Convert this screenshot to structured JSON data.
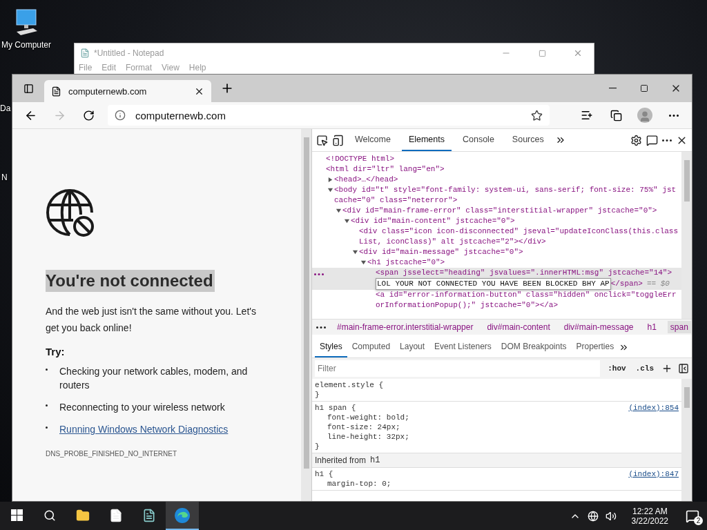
{
  "desktop_icons": [
    {
      "label": "My Computer"
    },
    {
      "label": "Da"
    },
    {
      "label": "N"
    }
  ],
  "notepad": {
    "title": "*Untitled - Notepad",
    "menu": [
      "File",
      "Edit",
      "Format",
      "View",
      "Help"
    ]
  },
  "browser": {
    "tabs": [
      {
        "title": "computernewb.com",
        "selected": true
      }
    ],
    "address": "computernewb.com"
  },
  "page": {
    "heading": "You're not connected",
    "heading_highlighted": true,
    "body": "And the web just isn't the same without you. Let's get you back online!",
    "try_label": "Try:",
    "suggestions": [
      {
        "kind": "text",
        "text": "Checking your network cables, modem, and routers"
      },
      {
        "kind": "text",
        "text": "Reconnecting to your wireless network"
      },
      {
        "kind": "link",
        "text": "Running Windows Network Diagnostics"
      }
    ],
    "error_code": "DNS_PROBE_FINISHED_NO_INTERNET"
  },
  "devtools": {
    "tabs": [
      {
        "label": "Welcome",
        "selected": false
      },
      {
        "label": "Elements",
        "selected": true
      },
      {
        "label": "Console",
        "selected": false
      },
      {
        "label": "Sources",
        "selected": false
      }
    ],
    "dom": [
      {
        "text": "<!DOCTYPE html>",
        "selected": false
      },
      {
        "text": "<html dir=\"ltr\" lang=\"en\">",
        "selected": false,
        "children": [
          {
            "expanded": false,
            "text": "<head>…</head>",
            "selected": false
          },
          {
            "expanded": true,
            "text": "<body id=\"t\" style=\"font-family: system-ui, sans-serif; font-size: 75%\" jstcache=\"0\" class=\"neterror\">",
            "selected": false,
            "children": [
              {
                "expanded": true,
                "text": "<div id=\"main-frame-error\" class=\"interstitial-wrapper\" jstcache=\"0\">",
                "selected": false,
                "children": [
                  {
                    "expanded": true,
                    "text": "<div id=\"main-content\" jstcache=\"0\">",
                    "selected": false,
                    "children": [
                      {
                        "text": "<div class=\"icon icon-disconnected\" jseval=\"updateIconClass(this.classList, iconClass)\" alt jstcache=\"2\"></div>",
                        "selected": false
                      },
                      {
                        "expanded": true,
                        "text": "<div id=\"main-message\" jstcache=\"0\">",
                        "selected": false,
                        "children": [
                          {
                            "expanded": true,
                            "text": "<h1 jstcache=\"0\">",
                            "selected": false,
                            "children": [
                              {
                                "text": "<span jsselect=\"heading\" jsvalues=\".innerHTML:msg\" jstcache=\"14\">",
                                "edit_value": "LOL YOUR NOT CONNECTED YOU HAVE BEEN BLOCKED BHY AP",
                                "close_tag": "</span>",
                                "suffix": "== $0",
                                "selected": true
                              },
                              {
                                "text": "<a id=\"error-information-button\" class=\"hidden\" onclick=\"toggleErrorInformationPopup();\" jstcache=\"0\"></a>",
                                "selected": false
                              }
                            ]
                          }
                        ]
                      }
                    ]
                  }
                ]
              }
            ]
          }
        ]
      }
    ],
    "breadcrumbs": [
      {
        "label": "#main-frame-error.interstitial-wrapper",
        "selected": false
      },
      {
        "label": "div#main-content",
        "selected": false
      },
      {
        "label": "div#main-message",
        "selected": false
      },
      {
        "label": "h1",
        "selected": false
      },
      {
        "label": "span",
        "selected": true
      }
    ],
    "style_tabs": [
      {
        "label": "Styles",
        "selected": true
      },
      {
        "label": "Computed",
        "selected": false
      },
      {
        "label": "Layout",
        "selected": false
      },
      {
        "label": "Event Listeners",
        "selected": false
      },
      {
        "label": "DOM Breakpoints",
        "selected": false
      },
      {
        "label": "Properties",
        "selected": false
      }
    ],
    "filter_placeholder": "Filter",
    "filter_toggles": [
      ":hov",
      ".cls"
    ],
    "rules": [
      {
        "kind": "rule",
        "selector": "element.style {",
        "closing": "}"
      },
      {
        "kind": "rule",
        "selector": "h1 span {",
        "source": "(index):854",
        "properties": [
          "font-weight: bold;",
          "font-size: 24px;",
          "line-height: 32px;"
        ],
        "closing": "}"
      },
      {
        "kind": "inherited",
        "label": "Inherited from",
        "selector": "h1"
      },
      {
        "kind": "rule",
        "selector": "h1 {",
        "source": "(index):847",
        "properties": [
          "margin-top: 0;"
        ]
      }
    ]
  },
  "taskbar": {
    "time": "12:22 AM",
    "date": "3/22/2022",
    "notification_count": "2"
  }
}
